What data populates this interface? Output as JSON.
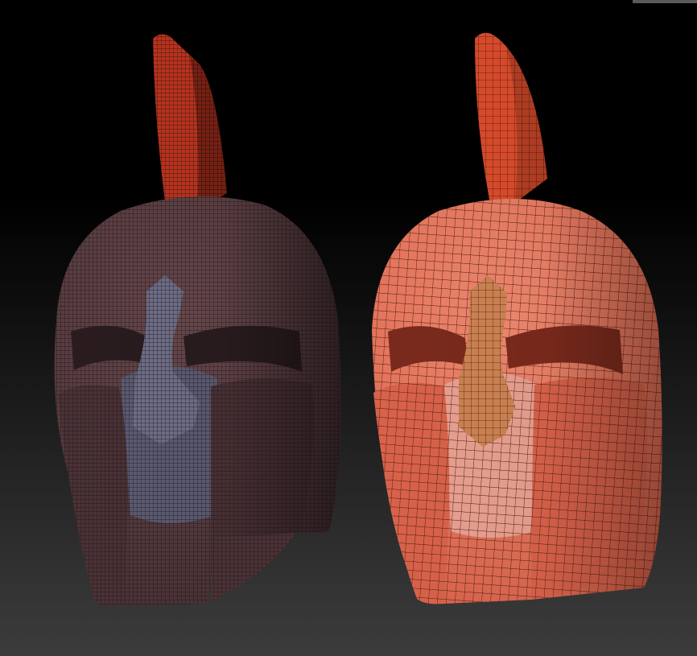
{
  "scene": {
    "background_top": "#000000",
    "background_bottom": "#3c3c3c",
    "corner_tab_color": "#5a5a5a"
  },
  "models": [
    {
      "id": "left-helmet",
      "mesh": "dense",
      "shell_color": "#4a3236",
      "shell_highlight": "#6a4a4e",
      "crest_color": "#b8321c",
      "nose_color": "#6c6c86",
      "inner_color": "#5c5c74",
      "wire_color": "#1e1416"
    },
    {
      "id": "right-helmet",
      "mesh": "sparse",
      "shell_color": "#d8624a",
      "shell_highlight": "#f08a70",
      "crest_color": "#d44a2a",
      "nose_color": "#c88050",
      "inner_color": "#e8a090",
      "wire_color": "#4a1a10"
    }
  ]
}
